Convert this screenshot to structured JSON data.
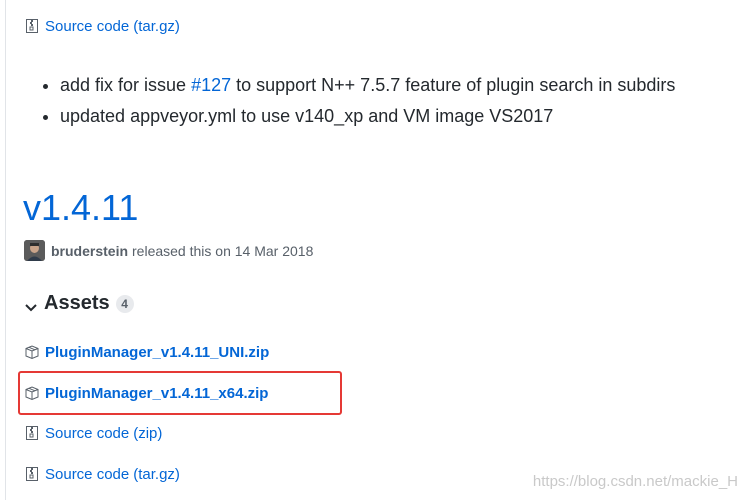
{
  "top_asset": {
    "label": "Source code",
    "ext": "(tar.gz)"
  },
  "release_notes": [
    {
      "prefix": "add fix for issue ",
      "link": "#127",
      "suffix": " to support N++ 7.5.7 feature of plugin search in subdirs"
    },
    {
      "prefix": "updated appveyor.yml to use v140_xp and VM image VS2017",
      "link": "",
      "suffix": ""
    }
  ],
  "release": {
    "version": "v1.4.11",
    "author": "bruderstein",
    "released_text": "released this on 14 Mar 2018"
  },
  "assets": {
    "title": "Assets",
    "count": "4",
    "items": [
      {
        "label": "PluginManager_v1.4.11_UNI.zip",
        "ext": ""
      },
      {
        "label": "PluginManager_v1.4.11_x64.zip",
        "ext": ""
      },
      {
        "label": "Source code",
        "ext": "(zip)"
      },
      {
        "label": "Source code",
        "ext": "(tar.gz)"
      }
    ]
  },
  "watermark": "https://blog.csdn.net/mackie_H",
  "colors": {
    "link": "#0366d6",
    "highlight": "#e53935"
  },
  "icons": {
    "archive": "file-zip-icon",
    "source": "file-code-icon",
    "chevron": "chevron-down-icon"
  }
}
